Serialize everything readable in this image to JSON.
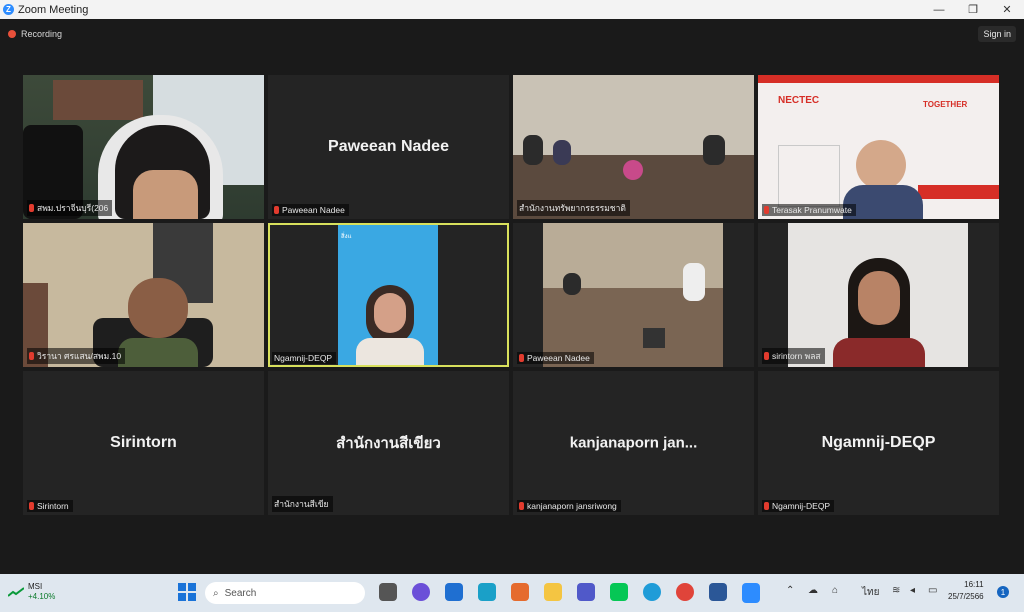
{
  "window": {
    "title": "Zoom Meeting",
    "min": "—",
    "max": "❐",
    "close": "✕"
  },
  "status": {
    "recording_label": "Recording",
    "signin_label": "Sign in"
  },
  "tiles": [
    {
      "label": "สพม.ปราจีนบุรี(206"
    },
    {
      "big": "Paweean Nadee",
      "label": "Paweean Nadee"
    },
    {
      "label": "สำนักงานทรัพยากรธรรมชาติ"
    },
    {
      "label": "Terasak Pranumwate",
      "logo": "NECTEC",
      "banner": "TOGETHER"
    },
    {
      "label": "วิรานา ศรแสน/สพม.10"
    },
    {
      "label": "Ngamnij-DEQP",
      "side_text": "สิ่งแ"
    },
    {
      "label": "Paweean Nadee"
    },
    {
      "label": "sirintorn พลส"
    },
    {
      "big": "Sirintorn",
      "label": "Sirintorn"
    },
    {
      "big": "สำนักงานสีเขียว",
      "label": "สำนักงานสีเขีย"
    },
    {
      "big": "kanjanaporn  jan...",
      "label": "kanjanaporn jansriwong"
    },
    {
      "big": "Ngamnij-DEQP",
      "label": "Ngamnij-DEQP"
    }
  ],
  "taskbar": {
    "stock_name": "MSI",
    "stock_change": "+4.10%",
    "search_placeholder": "Search",
    "lang": "ไทย",
    "time": "16:11",
    "date": "25/7/2566",
    "notifications": "1"
  },
  "colors": {
    "active_speaker": "#d8e05c",
    "tile_bg": "#242424",
    "mic_muted": "#e23b2e",
    "taskbar": "#dfe7ef"
  }
}
